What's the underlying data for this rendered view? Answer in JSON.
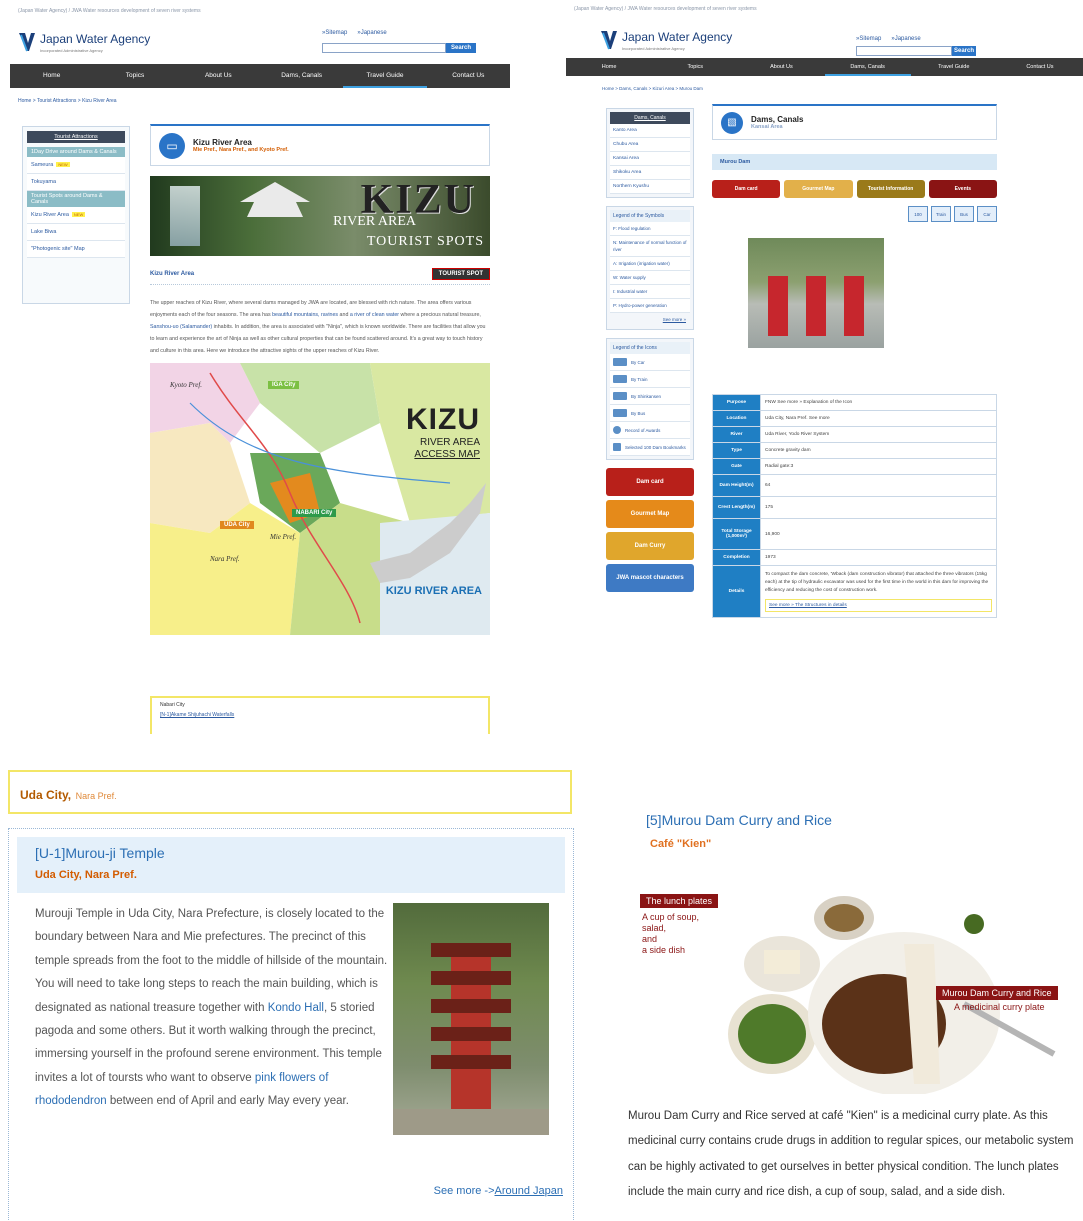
{
  "site": {
    "top_text": "(Japan Water Agency) / JWA Water resources development of seven river systems",
    "logo_name": "Japan Water Agency",
    "logo_sub": "Incorporated Administrative Agency",
    "sitemap": "»Sitemap",
    "japanese": "»Japanese",
    "search_label": "Search",
    "nav": [
      "Home",
      "Topics",
      "About Us",
      "Dams, Canals",
      "Travel Guide",
      "Contact Us"
    ]
  },
  "panel1": {
    "breadcrumb": "Home > Tourist Attractions > Kizu River Area",
    "side_head": "Tourist Attractions",
    "side_sub1": "1Day Drive around Dams & Canals",
    "side_items1": [
      "Sameura",
      "Tokuyama"
    ],
    "side_sub2": "Tourist Spots around Dams & Canals",
    "side_items2": [
      "Kizu River Area",
      "Lake Biwa",
      "\"Photogenic site\" Map"
    ],
    "new_badge": "NEW",
    "title": "Kizu River Area",
    "subtitle": "Mie Pref., Nara Pref., and Kyoto Pref.",
    "banner_big": "KIZU",
    "banner_river": "RIVER AREA",
    "banner_spots": "TOURIST SPOTS",
    "section_label": "Kizu River Area",
    "tourist_spot_badge": "TOURIST SPOT",
    "para_1": "The upper reaches of Kizu River, where several dams managed by JWA are located, are blessed with rich nature. The area offers various enjoyments each of the four seasons. The area has ",
    "para_link1": "beautiful mountains, ravines",
    "para_2": " and ",
    "para_link2": "a river of clean water",
    "para_3": " where a precious natural treasure, ",
    "para_link3": "Sanshou-uo (Salamander)",
    "para_4": " inhabits. In addition, the area is associated with \"Ninja\", which is known worldwide. There are facilities that allow you to learn and experience the art of Ninja as well as other cultural properties that can be found scattered around. It's a great way to touch history and culture in this area. Here we introduce the attractive sights of the upper reaches of Kizu River.",
    "map_kizu": "KIZU",
    "map_river_area": "RIVER AREA",
    "map_access": "ACCESS MAP",
    "map_iga": "IGA City",
    "map_nabari": "NABARI City",
    "map_uda": "UDA City",
    "map_kyoto": "Kyoto Pref.",
    "map_mie": "Mie Pref.",
    "map_nara": "Nara Pref.",
    "map_kra": "KIZU RIVER AREA",
    "bottom_city": "Nabari City",
    "bottom_link": "[N-1]Akame Shijuhachi Waterfalls"
  },
  "panel2": {
    "breadcrumb": "Home > Dams, Canals > Kizuri Area > Murou Dam",
    "side_head": "Dams, Canals",
    "side_items": [
      "Kanto Area",
      "Chubu Area",
      "Kansai Area",
      "Shikoku Area",
      "Northern Kyushu"
    ],
    "legend_sym_head": "Legend of the Symbols",
    "legend_syms": [
      "F: Flood regulation",
      "N: Maintenance of normal function of river",
      "A: Irrigation (irrigation water)",
      "W: Water supply",
      "I: Industrial water",
      "P: Hydro-power generation"
    ],
    "see_more": "See more »",
    "legend_icons_head": "Legend of the Icons",
    "legend_icons": [
      "By Car",
      "By Train",
      "By Shinkansen",
      "By Bus",
      "Record of Awards",
      "Selected 100 Dam Bookmarks"
    ],
    "promo": [
      "Dam card",
      "Gourmet Map",
      "Dam Curry",
      "JWA mascot characters"
    ],
    "title": "Dams, Canals",
    "subtitle": "Kansai Area",
    "dam_name": "Murou Dam",
    "buttons": [
      "Dam card",
      "Gourmet Map",
      "Tourist Information",
      "Events"
    ],
    "icon_boxes": [
      "100",
      "Train",
      "Bus",
      "Car"
    ],
    "spec": [
      {
        "k": "Purpose",
        "v": "FNW   See more » Explanation of the Icon"
      },
      {
        "k": "Location",
        "v": "Uda City, Nara Pref.   See more"
      },
      {
        "k": "River",
        "v": "Uda River, Yodo River System"
      },
      {
        "k": "Type",
        "v": "Concrete gravity dam"
      },
      {
        "k": "Gate",
        "v": "Radial gate:3"
      },
      {
        "k": "Dam Height(m)",
        "v": "64"
      },
      {
        "k": "Crest Length(m)",
        "v": "175"
      },
      {
        "k": "Total Storage (1,000m³)",
        "v": "16,900"
      },
      {
        "k": "Completion",
        "v": "1973"
      },
      {
        "k": "Details",
        "v": "To compact the dam concrete, 'Wback (dam construction vibrator) that attached the three vibrators (15kg each) at the tip of hydraulic excavator was used for the first time in the world in this dam for improving the efficiency and reducing the cost of construction work."
      }
    ],
    "details_more": "See more » The Structures in details"
  },
  "panel3": {
    "uda_city": "Uda City,",
    "uda_pref": "Nara Pref.",
    "temple_title": "[U-1]Murou-ji Temple",
    "temple_sub": "Uda City, Nara Pref.",
    "body_1": "Murouji Temple in Uda City, Nara Prefecture, is closely located to the boundary between Nara and Mie prefectures. The precinct of this temple spreads from the foot to the middle of hillside of the mountain. You will need to take long steps to reach the main building, which is designated as national treasure together with ",
    "body_link1": "Kondo Hall",
    "body_2": ", 5 storied pagoda and some others. But it worth walking through the precinct, immersing yourself in the profound serene environment. This temple invites a lot of toursts who want to observe ",
    "body_link2": "pink flowers of rhododendron",
    "body_3": " between end of April and early May every year.",
    "see_more": "See more ->",
    "see_more_link": "Around Japan"
  },
  "panel4": {
    "title": "[5]Murou Dam Curry and Rice",
    "subtitle": "Café \"Kien\"",
    "tag_lunch": "The lunch plates",
    "note_lunch_1": "A cup of soup,",
    "note_lunch_2": "salad,",
    "note_lunch_3": "and",
    "note_lunch_4": "a side dish",
    "tag_curry": "Murou Dam Curry and Rice",
    "note_curry": "A medicinal curry plate",
    "text": "Murou Dam Curry and Rice served at café \"Kien\" is a medicinal curry plate. As this medicinal curry contains crude drugs in addition to regular spices, our metabolic system can be highly activated to get ourselves in better physical condition. The lunch plates include the main curry and rice dish, a cup of soup, salad, and a side dish."
  },
  "colors": {
    "brand_blue": "#2a74c7",
    "link_blue": "#2c5aa0",
    "nav_dark": "#3a3a3a",
    "accent_orange": "#d35c00",
    "highlight_yellow": "#f3e667"
  }
}
